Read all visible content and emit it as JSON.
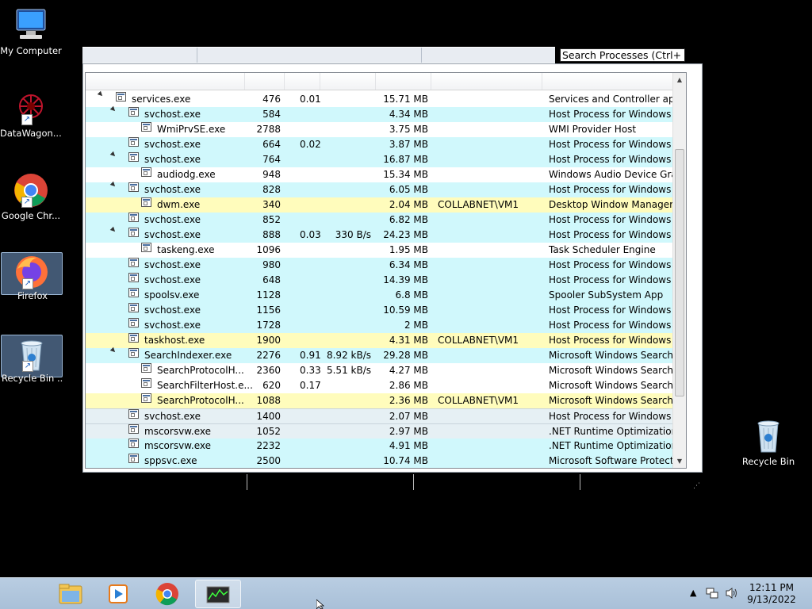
{
  "desktop": {
    "icons": [
      {
        "label": "My Computer"
      },
      {
        "label": "DataWagon...."
      },
      {
        "label": "Google Chr..."
      },
      {
        "label": "Firefox"
      },
      {
        "label": "Recycle Bin ..."
      },
      {
        "label": "Recycle Bin"
      }
    ]
  },
  "search": {
    "text": "Search Processes (Ctrl+"
  },
  "processes": [
    {
      "name": "services.exe",
      "pid": "476",
      "cpu": "0.01",
      "io": "",
      "mem": "15.71 MB",
      "user": "",
      "desc": "Services and Controller app",
      "color": "white",
      "indent": 0,
      "expander": true
    },
    {
      "name": "svchost.exe",
      "pid": "584",
      "cpu": "",
      "io": "",
      "mem": "4.34 MB",
      "user": "",
      "desc": "Host Process for Windows Ser...",
      "color": "cyan",
      "indent": 1,
      "expander": true
    },
    {
      "name": "WmiPrvSE.exe",
      "pid": "2788",
      "cpu": "",
      "io": "",
      "mem": "3.75 MB",
      "user": "",
      "desc": "WMI Provider Host",
      "color": "white",
      "indent": 2,
      "expander": false
    },
    {
      "name": "svchost.exe",
      "pid": "664",
      "cpu": "0.02",
      "io": "",
      "mem": "3.87 MB",
      "user": "",
      "desc": "Host Process for Windows Ser...",
      "color": "cyan",
      "indent": 1,
      "expander": false
    },
    {
      "name": "svchost.exe",
      "pid": "764",
      "cpu": "",
      "io": "",
      "mem": "16.87 MB",
      "user": "",
      "desc": "Host Process for Windows Ser...",
      "color": "cyan",
      "indent": 1,
      "expander": true
    },
    {
      "name": "audiodg.exe",
      "pid": "948",
      "cpu": "",
      "io": "",
      "mem": "15.34 MB",
      "user": "",
      "desc": "Windows Audio Device Graph...",
      "color": "white",
      "indent": 2,
      "expander": false
    },
    {
      "name": "svchost.exe",
      "pid": "828",
      "cpu": "",
      "io": "",
      "mem": "6.05 MB",
      "user": "",
      "desc": "Host Process for Windows Ser...",
      "color": "cyan",
      "indent": 1,
      "expander": true
    },
    {
      "name": "dwm.exe",
      "pid": "340",
      "cpu": "",
      "io": "",
      "mem": "2.04 MB",
      "user": "COLLABNET\\VM1",
      "desc": "Desktop Window Manager",
      "color": "yellow",
      "indent": 2,
      "expander": false
    },
    {
      "name": "svchost.exe",
      "pid": "852",
      "cpu": "",
      "io": "",
      "mem": "6.82 MB",
      "user": "",
      "desc": "Host Process for Windows Ser...",
      "color": "cyan",
      "indent": 1,
      "expander": false
    },
    {
      "name": "svchost.exe",
      "pid": "888",
      "cpu": "0.03",
      "io": "330 B/s",
      "mem": "24.23 MB",
      "user": "",
      "desc": "Host Process for Windows Ser...",
      "color": "cyan",
      "indent": 1,
      "expander": true
    },
    {
      "name": "taskeng.exe",
      "pid": "1096",
      "cpu": "",
      "io": "",
      "mem": "1.95 MB",
      "user": "",
      "desc": "Task Scheduler Engine",
      "color": "white",
      "indent": 2,
      "expander": false
    },
    {
      "name": "svchost.exe",
      "pid": "980",
      "cpu": "",
      "io": "",
      "mem": "6.34 MB",
      "user": "",
      "desc": "Host Process for Windows Ser...",
      "color": "cyan",
      "indent": 1,
      "expander": false
    },
    {
      "name": "svchost.exe",
      "pid": "648",
      "cpu": "",
      "io": "",
      "mem": "14.39 MB",
      "user": "",
      "desc": "Host Process for Windows Ser...",
      "color": "cyan",
      "indent": 1,
      "expander": false
    },
    {
      "name": "spoolsv.exe",
      "pid": "1128",
      "cpu": "",
      "io": "",
      "mem": "6.8 MB",
      "user": "",
      "desc": "Spooler SubSystem App",
      "color": "cyan",
      "indent": 1,
      "expander": false
    },
    {
      "name": "svchost.exe",
      "pid": "1156",
      "cpu": "",
      "io": "",
      "mem": "10.59 MB",
      "user": "",
      "desc": "Host Process for Windows Ser...",
      "color": "cyan",
      "indent": 1,
      "expander": false
    },
    {
      "name": "svchost.exe",
      "pid": "1728",
      "cpu": "",
      "io": "",
      "mem": "2 MB",
      "user": "",
      "desc": "Host Process for Windows Ser...",
      "color": "cyan",
      "indent": 1,
      "expander": false
    },
    {
      "name": "taskhost.exe",
      "pid": "1900",
      "cpu": "",
      "io": "",
      "mem": "4.31 MB",
      "user": "COLLABNET\\VM1",
      "desc": "Host Process for Windows Tas...",
      "color": "yellow",
      "indent": 1,
      "expander": false
    },
    {
      "name": "SearchIndexer.exe",
      "pid": "2276",
      "cpu": "0.91",
      "io": "8.92 kB/s",
      "mem": "29.28 MB",
      "user": "",
      "desc": "Microsoft Windows Search In...",
      "color": "cyan",
      "indent": 1,
      "expander": true
    },
    {
      "name": "SearchProtocolH...",
      "pid": "2360",
      "cpu": "0.33",
      "io": "5.51 kB/s",
      "mem": "4.27 MB",
      "user": "",
      "desc": "Microsoft Windows Search Pr...",
      "color": "white",
      "indent": 2,
      "expander": false
    },
    {
      "name": "SearchFilterHost.e...",
      "pid": "620",
      "cpu": "0.17",
      "io": "",
      "mem": "2.86 MB",
      "user": "",
      "desc": "Microsoft Windows Search Fil...",
      "color": "white",
      "indent": 2,
      "expander": false
    },
    {
      "name": "SearchProtocolH...",
      "pid": "1088",
      "cpu": "",
      "io": "",
      "mem": "2.36 MB",
      "user": "COLLABNET\\VM1",
      "desc": "Microsoft Windows Search Pr...",
      "color": "yellow",
      "indent": 2,
      "expander": false
    },
    {
      "name": "svchost.exe",
      "pid": "1400",
      "cpu": "",
      "io": "",
      "mem": "2.07 MB",
      "user": "",
      "desc": "Host Process for Windows Ser...",
      "color": "gray",
      "indent": 1,
      "expander": false
    },
    {
      "name": "mscorsvw.exe",
      "pid": "1052",
      "cpu": "",
      "io": "",
      "mem": "2.97 MB",
      "user": "",
      "desc": ".NET Runtime Optimization S...",
      "color": "gray",
      "indent": 1,
      "expander": false
    },
    {
      "name": "mscorsvw.exe",
      "pid": "2232",
      "cpu": "",
      "io": "",
      "mem": "4.91 MB",
      "user": "",
      "desc": ".NET Runtime Optimization S...",
      "color": "cyan",
      "indent": 1,
      "expander": false
    },
    {
      "name": "sppsvc.exe",
      "pid": "2500",
      "cpu": "",
      "io": "",
      "mem": "10.74 MB",
      "user": "",
      "desc": "Microsoft Software Protection...",
      "color": "cyan",
      "indent": 1,
      "expander": false
    }
  ],
  "taskbar": {
    "items": [
      "file-explorer",
      "media-player",
      "chrome",
      "process-explorer"
    ],
    "time": "12:11 PM",
    "date": "9/13/2022"
  },
  "colors": {
    "cyan": "#d0f8fc",
    "yellow": "#fffcbc",
    "taskbar": "#b9cde2"
  }
}
